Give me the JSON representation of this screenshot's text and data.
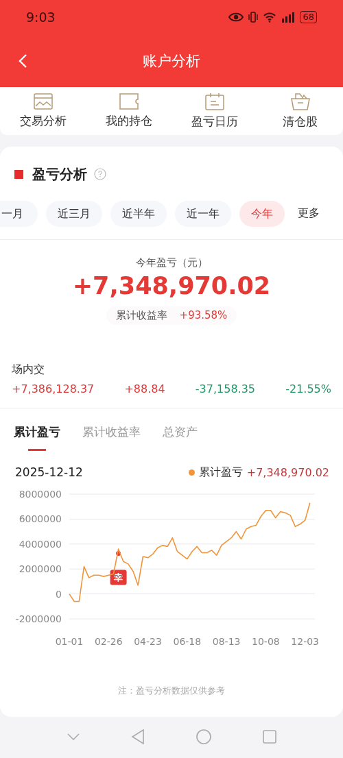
{
  "status_bar": {
    "time": "9:03",
    "battery": "68"
  },
  "header": {
    "title": "账户分析"
  },
  "shortcuts": [
    {
      "label": "交易分析"
    },
    {
      "label": "我的持仓"
    },
    {
      "label": "盈亏日历"
    },
    {
      "label": "清仓股"
    }
  ],
  "section": {
    "title": "盈亏分析"
  },
  "periods": [
    {
      "label": "一月",
      "selected": false
    },
    {
      "label": "近三月",
      "selected": false
    },
    {
      "label": "近半年",
      "selected": false
    },
    {
      "label": "近一年",
      "selected": false
    },
    {
      "label": "今年",
      "selected": true
    }
  ],
  "more": "更多",
  "summary": {
    "caption": "今年盈亏（元）",
    "amount": "+7,348,970.02",
    "rate_label": "累计收益率",
    "rate": "+93.58%"
  },
  "stats": {
    "label": "场内交",
    "values": [
      {
        "text": "+7,386,128.37",
        "color": "#e03a3a"
      },
      {
        "text": "+88.84",
        "color": "#e03a3a"
      },
      {
        "text": "-37,158.35",
        "color": "#1f9a6a"
      },
      {
        "text": "-21.55%",
        "color": "#1f9a6a"
      }
    ]
  },
  "chart_tabs": [
    {
      "label": "累计盈亏",
      "selected": true
    },
    {
      "label": "累计收益率",
      "selected": false
    },
    {
      "label": "总资产",
      "selected": false
    }
  ],
  "chart": {
    "date": "2025-12-12",
    "legend_value": "+7,348,970.02",
    "chart_data": {
      "type": "line",
      "categories": [
        "01-01",
        null,
        null,
        null,
        null,
        null,
        null,
        null,
        "02-26",
        null,
        null,
        null,
        null,
        null,
        null,
        null,
        "04-23",
        null,
        null,
        null,
        null,
        null,
        null,
        null,
        "06-18",
        null,
        null,
        null,
        null,
        null,
        null,
        null,
        "08-13",
        null,
        null,
        null,
        null,
        null,
        null,
        null,
        "10-08",
        null,
        null,
        null,
        null,
        null,
        null,
        null,
        "12-03",
        null
      ],
      "series": [
        {
          "name": "累计盈亏",
          "color": "#f0953a",
          "values": [
            0,
            -600000,
            -600000,
            2200000,
            1300000,
            1500000,
            1500000,
            1400000,
            1500000,
            1600000,
            3600000,
            2600000,
            2400000,
            1800000,
            700000,
            3000000,
            2900000,
            3200000,
            3700000,
            3900000,
            3800000,
            4500000,
            3400000,
            3100000,
            2800000,
            3400000,
            3800000,
            3300000,
            3300000,
            3500000,
            3100000,
            3900000,
            4200000,
            4500000,
            5000000,
            4400000,
            5200000,
            5400000,
            5500000,
            6200000,
            6700000,
            6700000,
            6100000,
            6600000,
            6500000,
            6300000,
            5400000,
            5600000,
            5900000,
            7300000
          ]
        }
      ],
      "ylim": [
        -2000000,
        8000000
      ],
      "yticks": [
        -2000000,
        0,
        2000000,
        4000000,
        6000000,
        8000000
      ],
      "grid": true,
      "annotations": [
        {
          "text": "幸"
        }
      ]
    }
  },
  "note": "注：盈亏分析数据仅供参考"
}
